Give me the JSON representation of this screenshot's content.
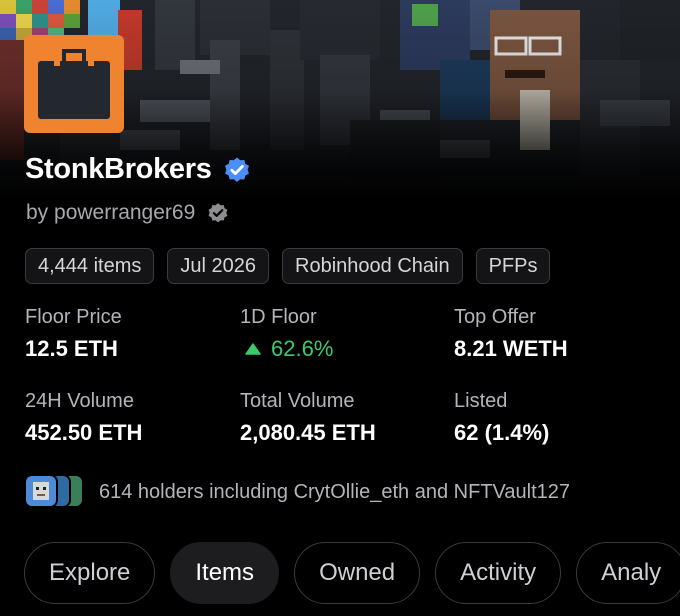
{
  "collection": {
    "name": "StonkBrokers",
    "creator": "by powerranger69"
  },
  "icons": {
    "avatar": "briefcase-icon",
    "verified": "verified-badge-icon",
    "creator_badge": "creator-badge-icon",
    "trend": "triangle-up-icon"
  },
  "colors": {
    "avatar_bg": "#f0832f",
    "verified": "#4a8ff7",
    "positive": "#3ec96c",
    "tab_active_bg": "#1d1d20"
  },
  "tags": [
    "4,444 items",
    "Jul 2026",
    "Robinhood Chain",
    "PFPs"
  ],
  "stats": {
    "floor_price": {
      "label": "Floor Price",
      "value": "12.5 ETH"
    },
    "floor_1d": {
      "label": "1D Floor",
      "value": "62.6%"
    },
    "top_offer": {
      "label": "Top Offer",
      "value": "8.21 WETH"
    },
    "volume_24h": {
      "label": "24H Volume",
      "value": "452.50 ETH"
    },
    "total_volume": {
      "label": "Total Volume",
      "value": "2,080.45 ETH"
    },
    "listed": {
      "label": "Listed",
      "value": "62 (1.4%)"
    }
  },
  "holders": {
    "text": "614 holders including CrytOllie_eth and NFTVault127"
  },
  "tabs": [
    "Explore",
    "Items",
    "Owned",
    "Activity",
    "Analy"
  ],
  "active_tab": "Items"
}
